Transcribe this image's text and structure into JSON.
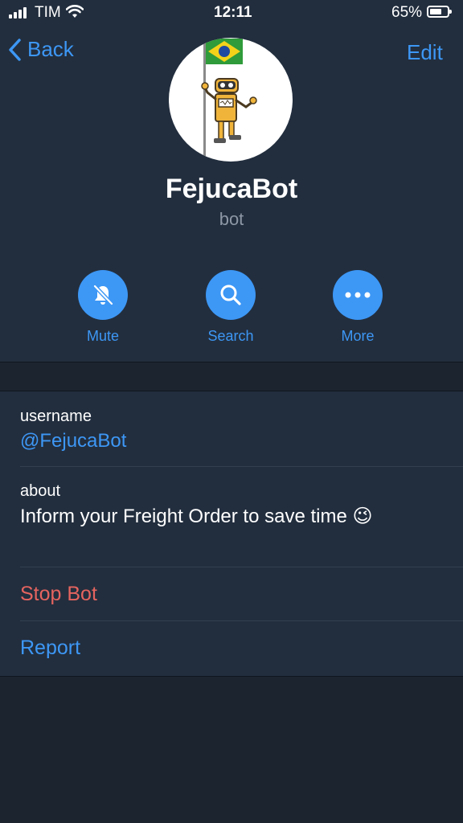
{
  "status_bar": {
    "carrier": "TIM",
    "time": "12:11",
    "battery_percent": "65%"
  },
  "nav": {
    "back_label": "Back",
    "edit_label": "Edit"
  },
  "profile": {
    "name": "FejucaBot",
    "subtitle": "bot"
  },
  "actions": [
    {
      "label": "Mute",
      "icon": "bell-slash-icon"
    },
    {
      "label": "Search",
      "icon": "search-icon"
    },
    {
      "label": "More",
      "icon": "ellipsis-icon"
    }
  ],
  "info": {
    "username_label": "username",
    "username_value": "@FejucaBot",
    "about_label": "about",
    "about_value": "Inform your Freight Order to save time 😉"
  },
  "menu": {
    "stop_bot_label": "Stop Bot",
    "report_label": "Report"
  },
  "colors": {
    "accent": "#3d97f5",
    "danger": "#e5645f",
    "panel": "#222e3e",
    "background": "#1c2430"
  }
}
